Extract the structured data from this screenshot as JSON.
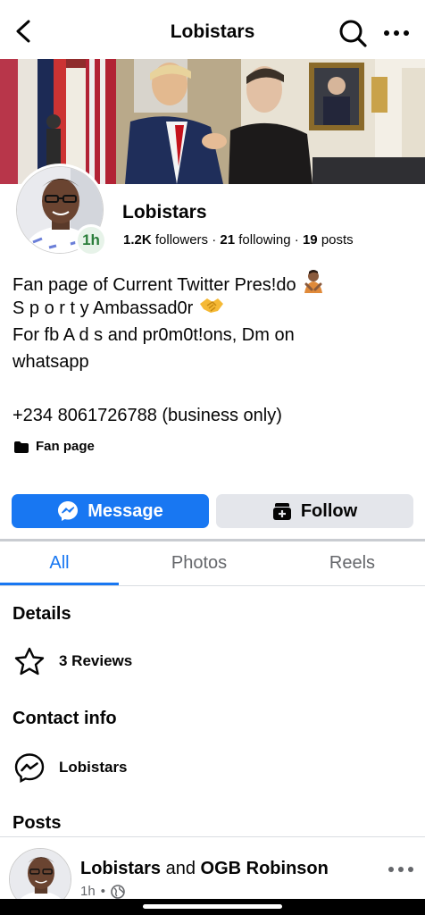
{
  "header": {
    "title": "Lobistars",
    "back_icon": "chevron-left-icon",
    "search_icon": "search-icon",
    "more_icon": "more-horizontal-icon"
  },
  "profile": {
    "name": "Lobistars",
    "story_badge": "1h",
    "followers_count": "1.2K",
    "followers_label": "followers",
    "following_count": "21",
    "following_label": "following",
    "posts_count": "19",
    "posts_label": "posts",
    "separator": "·"
  },
  "bio": {
    "line1": "Fan page of Current Twitter Pres!do",
    "line2": "S p o r t y Ambassad0r",
    "line3": "For fb  A d s and pr0m0t!ons, Dm on",
    "line4": "whatsapp",
    "line5": "+234 8061726788 (business only)"
  },
  "category": {
    "label": "Fan page"
  },
  "actions": {
    "message_label": "Message",
    "follow_label": "Follow"
  },
  "tabs": [
    {
      "label": "All",
      "active": true
    },
    {
      "label": "Photos",
      "active": false
    },
    {
      "label": "Reels",
      "active": false
    }
  ],
  "details": {
    "title": "Details",
    "reviews_label": "3 Reviews"
  },
  "contact": {
    "title": "Contact info",
    "messenger_label": "Lobistars"
  },
  "posts": {
    "title": "Posts",
    "author1": "Lobistars",
    "connector": "and",
    "author2": "OGB Robinson",
    "time": "1h",
    "dot": "•"
  },
  "colors": {
    "accent": "#1877f2",
    "secondary_button": "#e4e6eb",
    "muted_text": "#65676b",
    "story_badge_text": "#2a7d3a"
  }
}
